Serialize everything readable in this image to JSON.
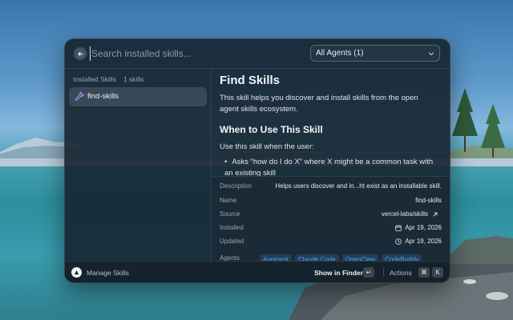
{
  "search": {
    "placeholder": "Search installed skills...",
    "filter_label": "All Agents (1)"
  },
  "sidebar": {
    "header_label": "Installed Skills",
    "header_count": "1 skills",
    "items": [
      {
        "label": "find-skills"
      }
    ]
  },
  "document": {
    "title": "Find Skills",
    "intro": "This skill helps you discover and install skills from the open agent skills ecosystem.",
    "heading": "When to Use This Skill",
    "paragraph": "Use this skill when the user:",
    "bullets": [
      "Asks “how do I do X” where X might be a common task with an existing skill"
    ]
  },
  "metadata": {
    "description_label": "Description",
    "description_value": "Helps users discover and in...ht exist as an installable skill.",
    "name_label": "Name",
    "name_value": "find-skills",
    "source_label": "Source",
    "source_value": "vercel-labs/skills",
    "installed_label": "Installed",
    "installed_value": "Apr 19, 2026",
    "updated_label": "Updated",
    "updated_value": "Apr 19, 2026",
    "agents_label": "Agents",
    "agents": [
      "Augment",
      "Claude Code",
      "OpenClaw",
      "CodeBuddy"
    ]
  },
  "footer": {
    "manage_label": "Manage Skills",
    "primary_action": "Show in Finder",
    "primary_key": "↵",
    "actions_label": "Actions",
    "actions_key_1": "⌘",
    "actions_key_2": "K"
  },
  "colors": {
    "accent_tag": "#4aa3f0",
    "window_bg": "#172632"
  }
}
